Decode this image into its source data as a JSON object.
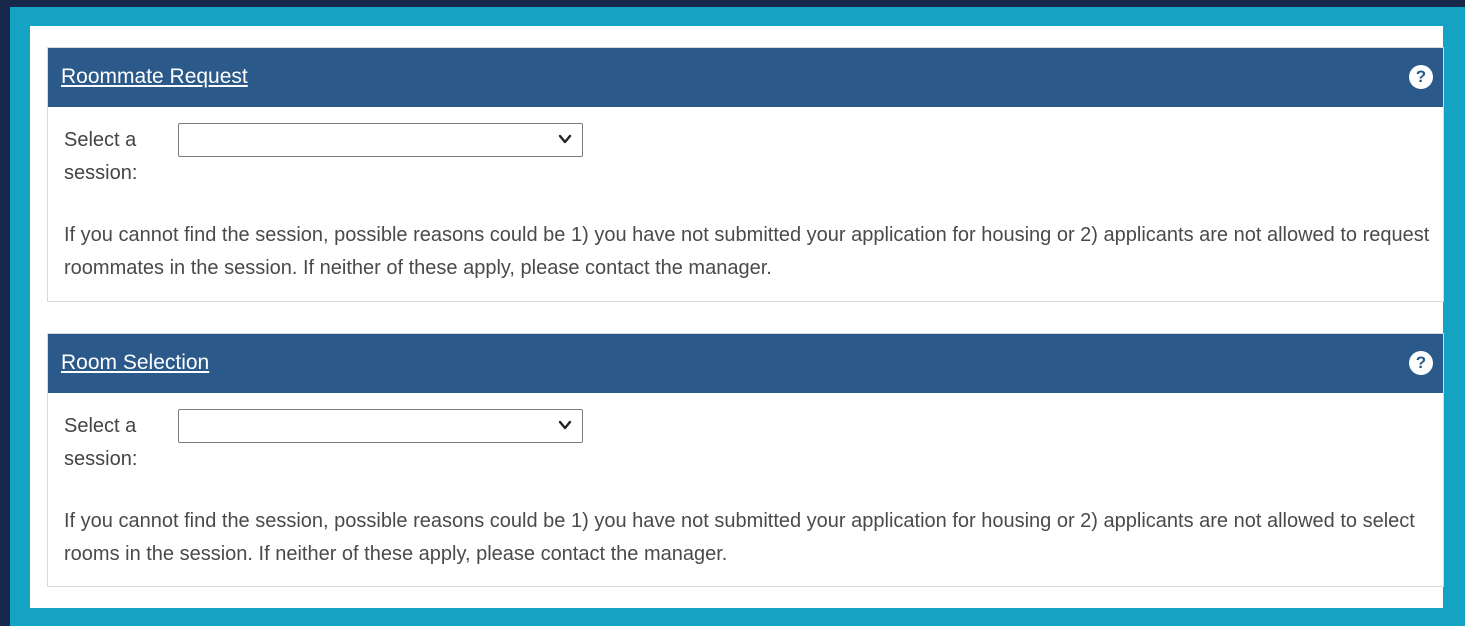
{
  "panels": [
    {
      "title": "Roommate Request",
      "help_icon": "question-circle-icon",
      "session_label": "Select a session:",
      "session_selected_value": "",
      "help_text": "If you cannot find the session, possible reasons could be 1) you have not submitted your application for housing or 2) applicants are not allowed to request roommates in the session. If neither of these apply, please contact the manager."
    },
    {
      "title": "Room Selection",
      "help_icon": "question-circle-icon",
      "session_label": "Select a session:",
      "session_selected_value": "",
      "help_text": "If you cannot find the session, possible reasons could be 1) you have not submitted your application for housing or 2) applicants are not allowed to select rooms in the session. If neither of these apply, please contact the manager."
    }
  ],
  "colors": {
    "page_background": "#17284b",
    "frame_accent": "#14a3c3",
    "header_background": "#2b5a8a",
    "header_text": "#ffffff",
    "body_text": "#4a4a4a"
  }
}
